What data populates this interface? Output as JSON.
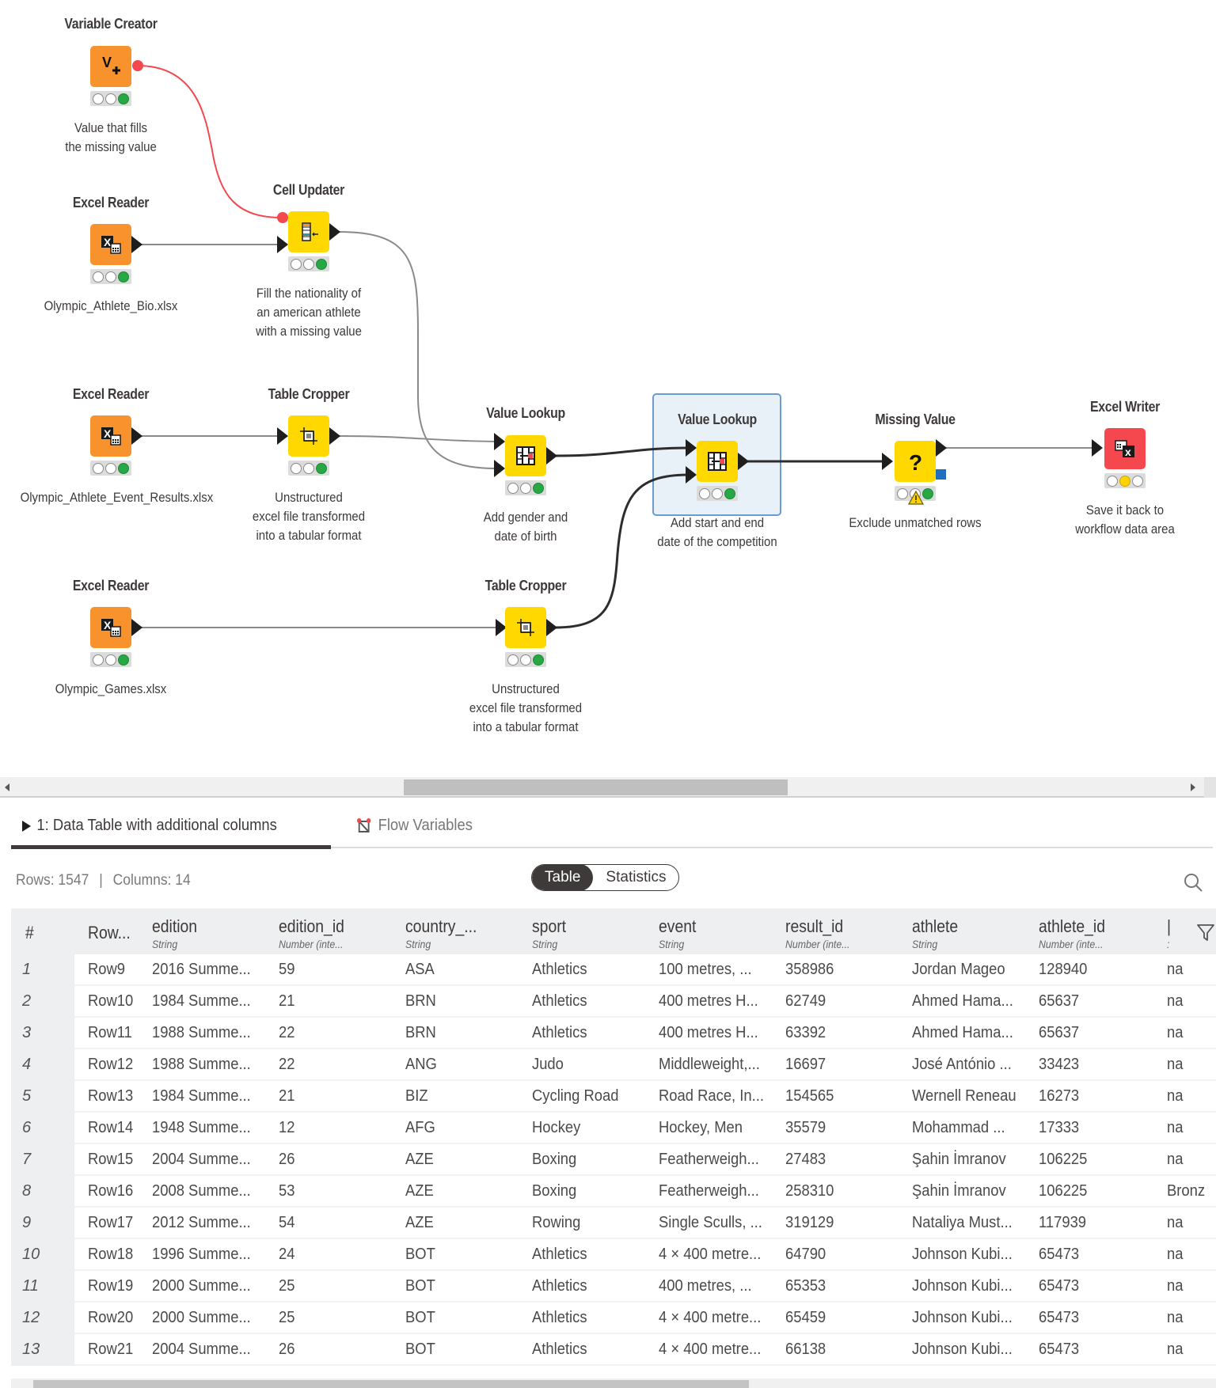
{
  "workflow": {
    "nodes": [
      {
        "id": "variable-creator",
        "title": "Variable Creator",
        "description": [
          "Value that fills",
          "the missing value"
        ],
        "color": "orange",
        "icon": "variable-plus-icon",
        "status": [
          "idle",
          "idle",
          "executed"
        ]
      },
      {
        "id": "excel-reader-1",
        "title": "Excel Reader",
        "description": [
          "Olympic_Athlete_Bio.xlsx"
        ],
        "color": "orange",
        "icon": "excel-reader-icon",
        "status": [
          "idle",
          "idle",
          "executed"
        ]
      },
      {
        "id": "cell-updater",
        "title": "Cell Updater",
        "description": [
          "Fill the nationality of",
          "an american athlete",
          "with a missing value"
        ],
        "color": "yellow",
        "icon": "cell-updater-icon",
        "status": [
          "idle",
          "idle",
          "executed"
        ]
      },
      {
        "id": "excel-reader-2",
        "title": "Excel Reader",
        "description": [
          "Olympic_Athlete_Event_Results.xlsx"
        ],
        "color": "orange",
        "icon": "excel-reader-icon",
        "status": [
          "idle",
          "idle",
          "executed"
        ]
      },
      {
        "id": "table-cropper-1",
        "title": "Table Cropper",
        "description": [
          "Unstructured",
          "excel file transformed",
          "into a tabular format"
        ],
        "color": "yellow",
        "icon": "table-cropper-icon",
        "status": [
          "idle",
          "idle",
          "executed"
        ]
      },
      {
        "id": "value-lookup-1",
        "title": "Value Lookup",
        "description": [
          "Add gender and",
          "date of birth"
        ],
        "color": "yellow",
        "icon": "value-lookup-icon",
        "status": [
          "idle",
          "idle",
          "executed"
        ]
      },
      {
        "id": "value-lookup-2",
        "title": "Value Lookup",
        "description": [
          "Add start and end",
          "date of the competition"
        ],
        "color": "yellow",
        "icon": "value-lookup-icon",
        "status": [
          "idle",
          "idle",
          "executed"
        ],
        "selected": true
      },
      {
        "id": "missing-value",
        "title": "Missing Value",
        "description": [
          "Exclude unmatched rows"
        ],
        "color": "yellow",
        "icon": "question-mark-icon",
        "status": [
          "idle",
          "idle",
          "executed"
        ],
        "warning": true
      },
      {
        "id": "excel-writer",
        "title": "Excel Writer",
        "description": [
          "Save it back to",
          "workflow data area"
        ],
        "color": "red",
        "icon": "excel-writer-icon",
        "status": [
          "idle",
          "configured",
          "idle"
        ]
      },
      {
        "id": "excel-reader-3",
        "title": "Excel Reader",
        "description": [
          "Olympic_Games.xlsx"
        ],
        "color": "orange",
        "icon": "excel-reader-icon",
        "status": [
          "idle",
          "idle",
          "executed"
        ]
      },
      {
        "id": "table-cropper-2",
        "title": "Table Cropper",
        "description": [
          "Unstructured",
          "excel file transformed",
          "into a tabular format"
        ],
        "color": "yellow",
        "icon": "table-cropper-icon",
        "status": [
          "idle",
          "idle",
          "executed"
        ]
      }
    ],
    "colors": {
      "orange": "#f7922d",
      "yellow": "#ffd800",
      "red": "#f4474e",
      "flow_variable": "#f4474e",
      "selection": "#6b9bd1"
    }
  },
  "panel": {
    "tabs": [
      {
        "label": "1: Data Table with additional columns",
        "active": true
      },
      {
        "label": "Flow Variables",
        "active": false
      }
    ],
    "rows_label": "Rows: 1547",
    "separator": "|",
    "columns_label": "Columns: 14",
    "view_toggle": {
      "options": [
        "Table",
        "Statistics"
      ],
      "selected": "Table"
    }
  },
  "table": {
    "headers": [
      {
        "name": "#",
        "type": ""
      },
      {
        "name": "Row...",
        "type": ""
      },
      {
        "name": "edition",
        "type": "String"
      },
      {
        "name": "edition_id",
        "type": "Number (inte..."
      },
      {
        "name": "country_...",
        "type": "String"
      },
      {
        "name": "sport",
        "type": "String"
      },
      {
        "name": "event",
        "type": "String"
      },
      {
        "name": "result_id",
        "type": "Number (inte..."
      },
      {
        "name": "athlete",
        "type": "String"
      },
      {
        "name": "athlete_id",
        "type": "Number (inte..."
      },
      {
        "name": "|",
        "type": ":"
      }
    ],
    "rows": [
      [
        "1",
        "Row9",
        "2016 Summe...",
        "59",
        "ASA",
        "Athletics",
        "100 metres, ...",
        "358986",
        "Jordan Mageo",
        "128940",
        "na"
      ],
      [
        "2",
        "Row10",
        "1984 Summe...",
        "21",
        "BRN",
        "Athletics",
        "400 metres H...",
        "62749",
        "Ahmed Hama...",
        "65637",
        "na"
      ],
      [
        "3",
        "Row11",
        "1988 Summe...",
        "22",
        "BRN",
        "Athletics",
        "400 metres H...",
        "63392",
        "Ahmed Hama...",
        "65637",
        "na"
      ],
      [
        "4",
        "Row12",
        "1988 Summe...",
        "22",
        "ANG",
        "Judo",
        "Middleweight,...",
        "16697",
        "José António ...",
        "33423",
        "na"
      ],
      [
        "5",
        "Row13",
        "1984 Summe...",
        "21",
        "BIZ",
        "Cycling Road",
        "Road Race, In...",
        "154565",
        "Wernell Reneau",
        "16273",
        "na"
      ],
      [
        "6",
        "Row14",
        "1948 Summe...",
        "12",
        "AFG",
        "Hockey",
        "Hockey, Men",
        "35579",
        "Mohammad ...",
        "17333",
        "na"
      ],
      [
        "7",
        "Row15",
        "2004 Summe...",
        "26",
        "AZE",
        "Boxing",
        "Featherweigh...",
        "27483",
        "Şahin İmranov",
        "106225",
        "na"
      ],
      [
        "8",
        "Row16",
        "2008 Summe...",
        "53",
        "AZE",
        "Boxing",
        "Featherweigh...",
        "258310",
        "Şahin İmranov",
        "106225",
        "Bronz"
      ],
      [
        "9",
        "Row17",
        "2012 Summe...",
        "54",
        "AZE",
        "Rowing",
        "Single Sculls, ...",
        "319129",
        "Nataliya Must...",
        "117939",
        "na"
      ],
      [
        "10",
        "Row18",
        "1996 Summe...",
        "24",
        "BOT",
        "Athletics",
        "4 × 400 metre...",
        "64790",
        "Johnson Kubi...",
        "65473",
        "na"
      ],
      [
        "11",
        "Row19",
        "2000 Summe...",
        "25",
        "BOT",
        "Athletics",
        "400 metres, ...",
        "65353",
        "Johnson Kubi...",
        "65473",
        "na"
      ],
      [
        "12",
        "Row20",
        "2000 Summe...",
        "25",
        "BOT",
        "Athletics",
        "4 × 400 metre...",
        "65459",
        "Johnson Kubi...",
        "65473",
        "na"
      ],
      [
        "13",
        "Row21",
        "2004 Summe...",
        "26",
        "BOT",
        "Athletics",
        "4 × 400 metre...",
        "66138",
        "Johnson Kubi...",
        "65473",
        "na"
      ]
    ]
  }
}
